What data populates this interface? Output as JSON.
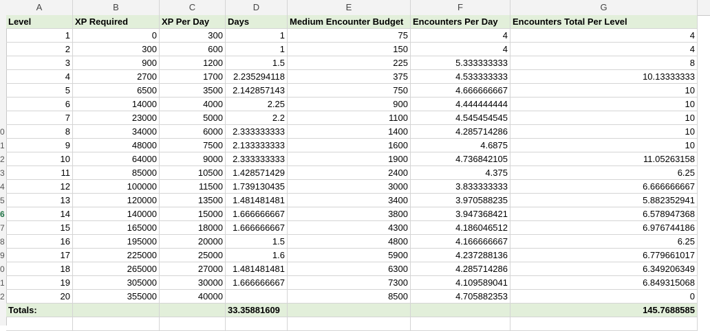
{
  "columns": [
    "A",
    "B",
    "C",
    "D",
    "E",
    "F",
    "G"
  ],
  "headers": [
    "Level",
    "XP Required",
    "XP Per Day",
    "Days",
    "Medium Encounter Budget",
    "Encounters Per Day",
    "Encounters Total Per Level"
  ],
  "row_numbers": [
    "",
    "",
    "",
    "",
    "",
    "",
    "",
    "",
    "0",
    "1",
    "2",
    "3",
    "4",
    "5",
    "6",
    "7",
    "8",
    "9",
    "0",
    "1",
    "2"
  ],
  "rows": [
    [
      "1",
      "0",
      "300",
      "1",
      "75",
      "4",
      "4"
    ],
    [
      "2",
      "300",
      "600",
      "1",
      "150",
      "4",
      "4"
    ],
    [
      "3",
      "900",
      "1200",
      "1.5",
      "225",
      "5.333333333",
      "8"
    ],
    [
      "4",
      "2700",
      "1700",
      "2.235294118",
      "375",
      "4.533333333",
      "10.13333333"
    ],
    [
      "5",
      "6500",
      "3500",
      "2.142857143",
      "750",
      "4.666666667",
      "10"
    ],
    [
      "6",
      "14000",
      "4000",
      "2.25",
      "900",
      "4.444444444",
      "10"
    ],
    [
      "7",
      "23000",
      "5000",
      "2.2",
      "1100",
      "4.545454545",
      "10"
    ],
    [
      "8",
      "34000",
      "6000",
      "2.333333333",
      "1400",
      "4.285714286",
      "10"
    ],
    [
      "9",
      "48000",
      "7500",
      "2.133333333",
      "1600",
      "4.6875",
      "10"
    ],
    [
      "10",
      "64000",
      "9000",
      "2.333333333",
      "1900",
      "4.736842105",
      "11.05263158"
    ],
    [
      "11",
      "85000",
      "10500",
      "1.428571429",
      "2400",
      "4.375",
      "6.25"
    ],
    [
      "12",
      "100000",
      "11500",
      "1.739130435",
      "3000",
      "3.833333333",
      "6.666666667"
    ],
    [
      "13",
      "120000",
      "13500",
      "1.481481481",
      "3400",
      "3.970588235",
      "5.882352941"
    ],
    [
      "14",
      "140000",
      "15000",
      "1.666666667",
      "3800",
      "3.947368421",
      "6.578947368"
    ],
    [
      "15",
      "165000",
      "18000",
      "1.666666667",
      "4300",
      "4.186046512",
      "6.976744186"
    ],
    [
      "16",
      "195000",
      "20000",
      "1.5",
      "4800",
      "4.166666667",
      "6.25"
    ],
    [
      "17",
      "225000",
      "25000",
      "1.6",
      "5900",
      "4.237288136",
      "6.779661017"
    ],
    [
      "18",
      "265000",
      "27000",
      "1.481481481",
      "6300",
      "4.285714286",
      "6.349206349"
    ],
    [
      "19",
      "305000",
      "30000",
      "1.666666667",
      "7300",
      "4.109589041",
      "6.849315068"
    ],
    [
      "20",
      "355000",
      "40000",
      "",
      "8500",
      "4.705882353",
      "0"
    ]
  ],
  "totals": {
    "label": "Totals:",
    "days": "33.35881609",
    "encounters_total": "145.7688585"
  },
  "colors": {
    "header_fill": "#e2efda",
    "totals_fill": "#e2efda",
    "gridline": "#d4d4d4",
    "active_row_number": "#217346"
  }
}
